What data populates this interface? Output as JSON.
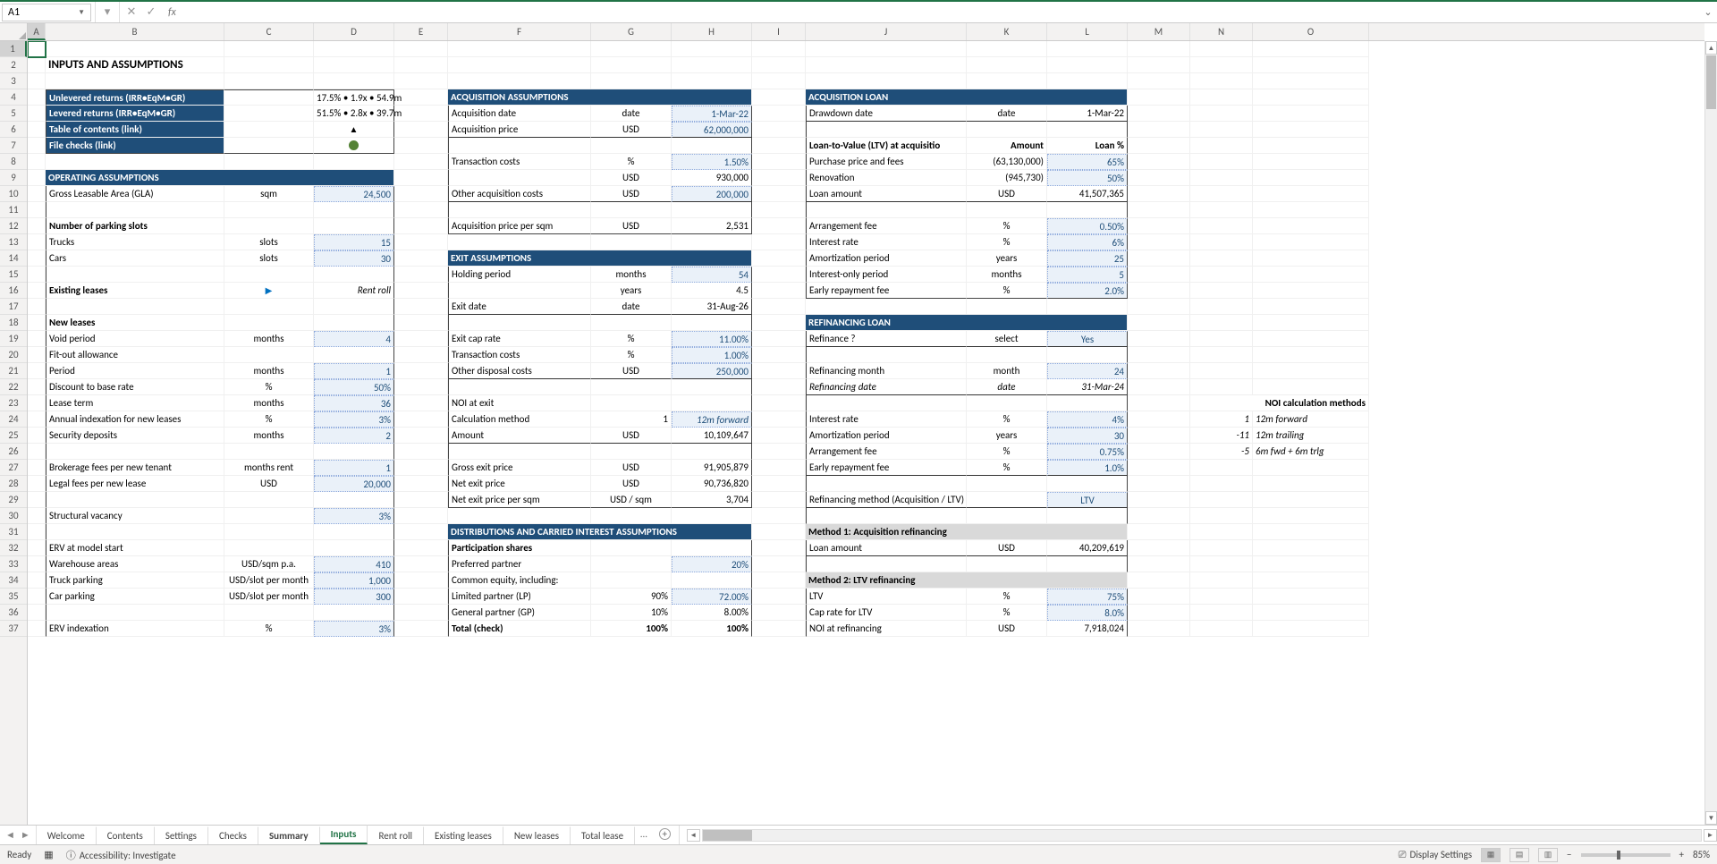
{
  "nameBox": "A1",
  "formulaValue": "",
  "mainTitle": "INPUTS AND ASSUMPTIONS",
  "returns": {
    "unlevered": {
      "label": "Unlevered returns (IRR•EqM•GR)",
      "value": "17.5% • 1.9x • 54.9m"
    },
    "levered": {
      "label": "Levered returns (IRR•EqM•GR)",
      "value": "51.5% • 2.8x • 39.7m"
    },
    "toc": "Table of contents (link)",
    "checks": "File checks (link)"
  },
  "operating": {
    "header": "OPERATING ASSUMPTIONS",
    "gla": {
      "label": "Gross Leasable Area (GLA)",
      "unit": "sqm",
      "value": "24,500"
    },
    "parkingHeader": "Number of parking slots",
    "trucks": {
      "label": "Trucks",
      "unit": "slots",
      "value": "15"
    },
    "cars": {
      "label": "Cars",
      "unit": "slots",
      "value": "30"
    },
    "existing": {
      "label": "Existing leases",
      "note": "Rent roll"
    },
    "newLeases": "New leases",
    "void": {
      "label": "Void period",
      "unit": "months",
      "value": "4"
    },
    "fitout": "Fit-out allowance",
    "period": {
      "label": "Period",
      "unit": "months",
      "value": "1"
    },
    "discount": {
      "label": "Discount to base rate",
      "unit": "%",
      "value": "50%"
    },
    "leaseTerm": {
      "label": "Lease term",
      "unit": "months",
      "value": "36"
    },
    "indexation": {
      "label": "Annual indexation for new leases",
      "unit": "%",
      "value": "3%"
    },
    "deposits": {
      "label": "Security deposits",
      "unit": "months",
      "value": "2"
    },
    "brokerage": {
      "label": "Brokerage fees per new tenant",
      "unit": "months rent",
      "value": "1"
    },
    "legal": {
      "label": "Legal fees per new lease",
      "unit": "USD",
      "value": "20,000"
    },
    "structVacancy": {
      "label": "Structural vacancy",
      "value": "3%"
    },
    "erv": "ERV at model start",
    "warehouse": {
      "label": "Warehouse areas",
      "unit": "USD/sqm p.a.",
      "value": "410"
    },
    "truckPark": {
      "label": "Truck parking",
      "unit": "USD/slot per month",
      "value": "1,000"
    },
    "carPark": {
      "label": "Car parking",
      "unit": "USD/slot per month",
      "value": "300"
    },
    "ervIndex": {
      "label": "ERV indexation",
      "unit": "%",
      "value": "3%"
    }
  },
  "acquisition": {
    "header": "ACQUISITION ASSUMPTIONS",
    "date": {
      "label": "Acquisition date",
      "unit": "date",
      "value": "1-Mar-22"
    },
    "price": {
      "label": "Acquisition price",
      "unit": "USD",
      "value": "62,000,000"
    },
    "txnCosts": {
      "label": "Transaction costs",
      "unit": "%",
      "value": "1.50%"
    },
    "txnUsd": {
      "unit": "USD",
      "value": "930,000"
    },
    "otherAcq": {
      "label": "Other acquisition costs",
      "unit": "USD",
      "value": "200,000"
    },
    "pricePerSqm": {
      "label": "Acquisition price per sqm",
      "unit": "USD",
      "value": "2,531"
    }
  },
  "exit": {
    "header": "EXIT ASSUMPTIONS",
    "holding": {
      "label": "Holding period",
      "unit": "months",
      "value": "54"
    },
    "years": {
      "unit": "years",
      "value": "4.5"
    },
    "exitDate": {
      "label": "Exit date",
      "unit": "date",
      "value": "31-Aug-26"
    },
    "capRate": {
      "label": "Exit cap rate",
      "unit": "%",
      "value": "11.00%"
    },
    "txnCosts": {
      "label": "Transaction costs",
      "unit": "%",
      "value": "1.00%"
    },
    "otherDisp": {
      "label": "Other disposal costs",
      "unit": "USD",
      "value": "250,000"
    },
    "noiExit": "NOI at exit",
    "calcMethod": {
      "label": "Calculation method",
      "idx": "1",
      "value": "12m forward"
    },
    "amount": {
      "label": "Amount",
      "unit": "USD",
      "value": "10,109,647"
    },
    "grossExit": {
      "label": "Gross exit price",
      "unit": "USD",
      "value": "91,905,879"
    },
    "netExit": {
      "label": "Net exit price",
      "unit": "USD",
      "value": "90,736,820"
    },
    "netSqm": {
      "label": "Net exit price per sqm",
      "unit": "USD / sqm",
      "value": "3,704"
    }
  },
  "dist": {
    "header": "DISTRIBUTIONS AND CARRIED INTEREST ASSUMPTIONS",
    "partShares": "Participation shares",
    "prefPartner": {
      "label": "Preferred partner",
      "value": "20%"
    },
    "commonEq": "Common equity, including:",
    "lp": {
      "label": "Limited partner (LP)",
      "pct1": "90%",
      "pct2": "72.00%"
    },
    "gp": {
      "label": "General partner (GP)",
      "pct1": "10%",
      "pct2": "8.00%"
    },
    "total": {
      "label": "Total (check)",
      "pct1": "100%",
      "pct2": "100%"
    }
  },
  "acqLoan": {
    "header": "ACQUISITION LOAN",
    "draw": {
      "label": "Drawdown date",
      "unit": "date",
      "value": "1-Mar-22"
    },
    "ltvHdr": {
      "label": "Loan-to-Value (LTV) at acquisitio",
      "col1": "Amount",
      "col2": "Loan %"
    },
    "purchase": {
      "label": "Purchase price and fees",
      "amount": "(63,130,000)",
      "pct": "65%"
    },
    "renovation": {
      "label": "Renovation",
      "amount": "(945,730)",
      "pct": "50%"
    },
    "loanAmt": {
      "label": "Loan amount",
      "unit": "USD",
      "value": "41,507,365"
    },
    "arrFee": {
      "label": "Arrangement fee",
      "unit": "%",
      "value": "0.50%"
    },
    "intRate": {
      "label": "Interest rate",
      "unit": "%",
      "value": "6%"
    },
    "amort": {
      "label": "Amortization period",
      "unit": "years",
      "value": "25"
    },
    "intOnly": {
      "label": "Interest-only period",
      "unit": "months",
      "value": "5"
    },
    "earlyRepay": {
      "label": "Early repayment fee",
      "unit": "%",
      "value": "2.0%"
    }
  },
  "refin": {
    "header": "REFINANCING LOAN",
    "refinance": {
      "label": "Refinance ?",
      "unit": "select",
      "value": "Yes"
    },
    "month": {
      "label": "Refinancing month",
      "unit": "month",
      "value": "24"
    },
    "date": {
      "label": "Refinancing date",
      "unit": "date",
      "value": "31-Mar-24"
    },
    "intRate": {
      "label": "Interest rate",
      "unit": "%",
      "value": "4%"
    },
    "amort": {
      "label": "Amortization period",
      "unit": "years",
      "value": "30"
    },
    "arrFee": {
      "label": "Arrangement fee",
      "unit": "%",
      "value": "0.75%"
    },
    "earlyRepay": {
      "label": "Early repayment fee",
      "unit": "%",
      "value": "1.0%"
    },
    "method": {
      "label": "Refinancing method (Acquisition / LTV)",
      "value": "LTV"
    },
    "m1": "Method 1: Acquisition refinancing",
    "m1Loan": {
      "label": "Loan amount",
      "unit": "USD",
      "value": "40,209,619"
    },
    "m2": "Method 2: LTV refinancing",
    "ltv": {
      "label": "LTV",
      "unit": "%",
      "value": "75%"
    },
    "capRate": {
      "label": "Cap rate for LTV",
      "unit": "%",
      "value": "8.0%"
    },
    "noiRef": {
      "label": "NOI at refinancing",
      "unit": "USD",
      "value": "7,918,024"
    }
  },
  "noiMethods": {
    "header": "NOI calculation methods",
    "m1": {
      "idx": "1",
      "label": "12m forward"
    },
    "m2": {
      "idx": "-11",
      "label": "12m trailing"
    },
    "m3": {
      "idx": "-5",
      "label": "6m fwd + 6m trlg"
    }
  },
  "tabs": [
    "Welcome",
    "Contents",
    "Settings",
    "Checks",
    "Summary",
    "Inputs",
    "Rent roll",
    "Existing leases",
    "New leases",
    "Total lease"
  ],
  "activeTab": "Inputs",
  "boldTab": "Summary",
  "status": {
    "ready": "Ready",
    "accessibility": "Accessibility: Investigate",
    "displaySettings": "Display Settings",
    "zoom": "85%"
  },
  "cols": [
    "A",
    "B",
    "C",
    "D",
    "E",
    "F",
    "G",
    "H",
    "I",
    "J",
    "K",
    "L",
    "M",
    "N",
    "O"
  ]
}
